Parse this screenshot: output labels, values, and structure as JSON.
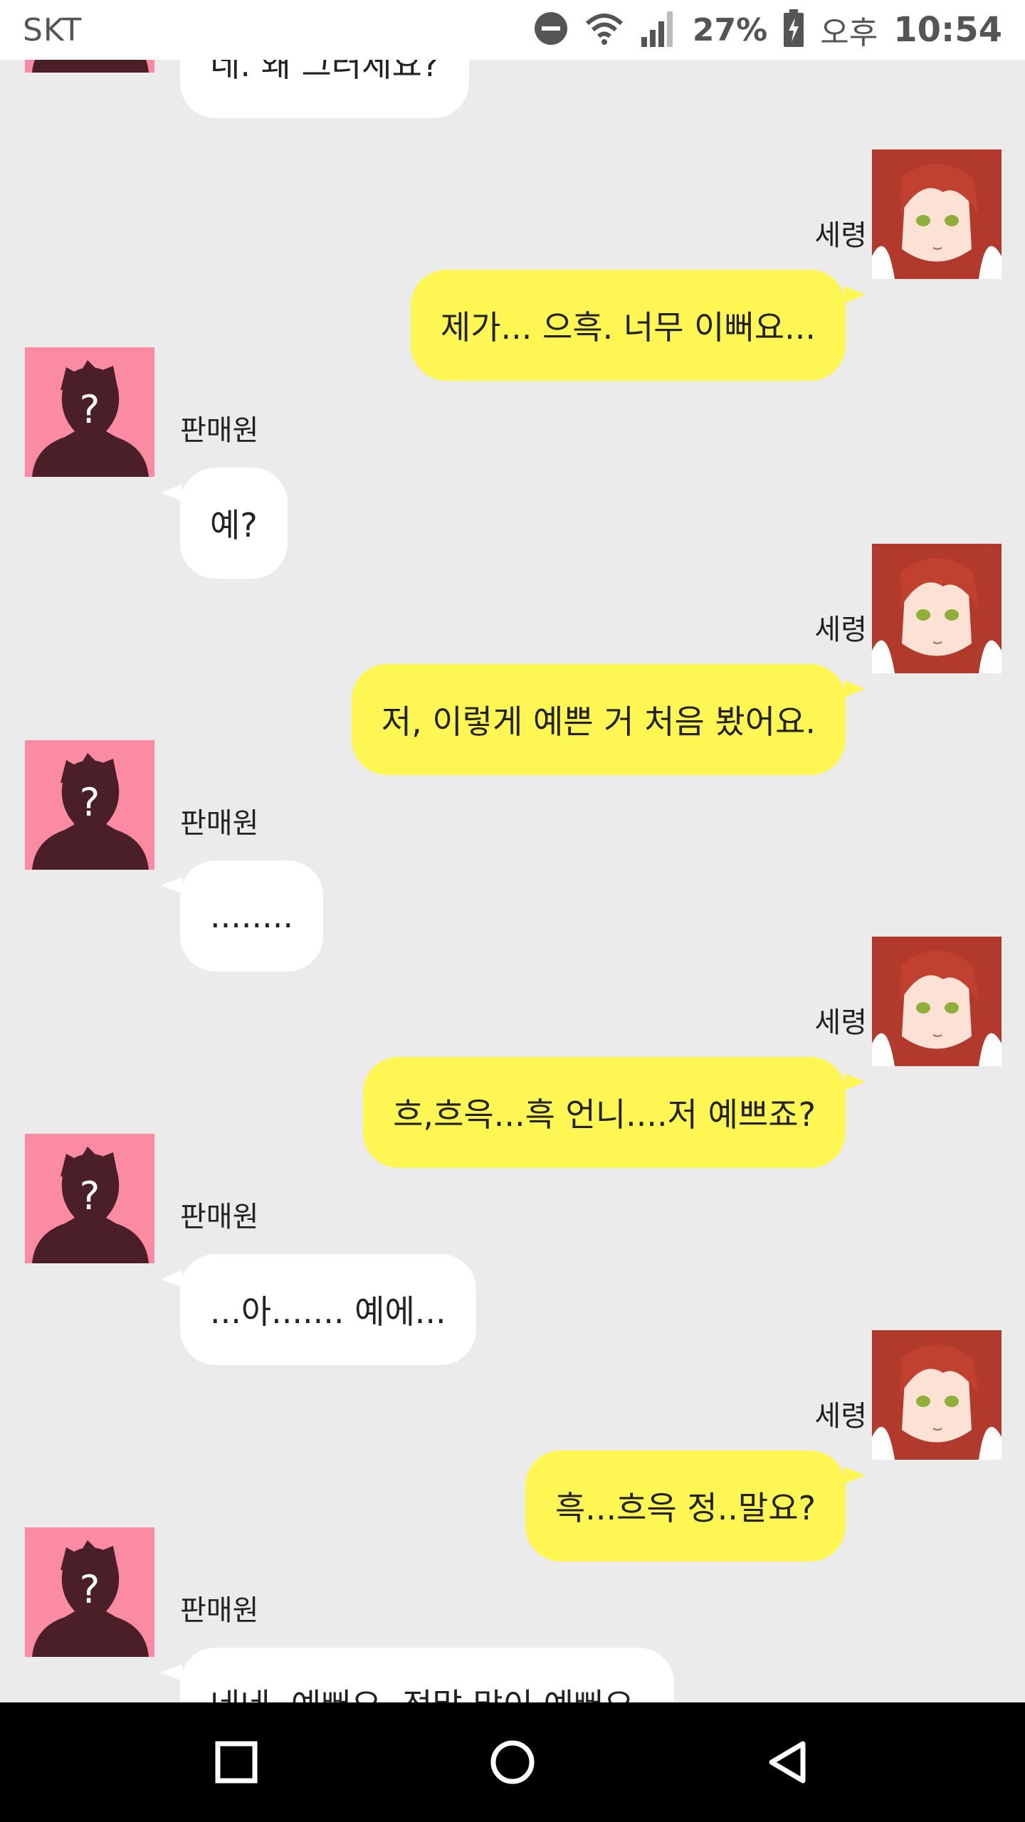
{
  "status_bar": {
    "carrier": "SKT",
    "battery_percent": "27%",
    "ampm": "오후",
    "time": "10:54",
    "icons": [
      "dnd-icon",
      "wifi-icon",
      "signal-icon",
      "battery-charging-icon"
    ]
  },
  "chat": {
    "top_partial_message": {
      "sender": "판매원",
      "text": "네. 왜 그러세요?"
    },
    "messages": [
      {
        "side": "right",
        "sender": "세령",
        "text": "제가... 으흑. 너무 이뻐요..."
      },
      {
        "side": "left",
        "sender": "판매원",
        "text": "예?"
      },
      {
        "side": "right",
        "sender": "세령",
        "text": "저, 이렇게 예쁜 거 처음 봤어요."
      },
      {
        "side": "left",
        "sender": "판매원",
        "text": "........"
      },
      {
        "side": "right",
        "sender": "세령",
        "text": "흐,흐윽...흑 언니....저 예쁘죠?"
      },
      {
        "side": "left",
        "sender": "판매원",
        "text": "...아....... 예에..."
      },
      {
        "side": "right",
        "sender": "세령",
        "text": "흑...흐윽 정..말요?"
      },
      {
        "side": "left",
        "sender": "판매원",
        "text": "네네, 예뻐요. 정말 많이 예뻐요."
      }
    ]
  },
  "colors": {
    "background": "#ebebeb",
    "my_bubble": "#fef653",
    "other_bubble": "#ffffff",
    "unknown_avatar_bg": "#fa8ba2",
    "unknown_avatar_silhouette": "#4a1f28"
  },
  "nav_bar": {
    "buttons": [
      "recent-apps-icon",
      "home-icon",
      "back-icon"
    ]
  }
}
